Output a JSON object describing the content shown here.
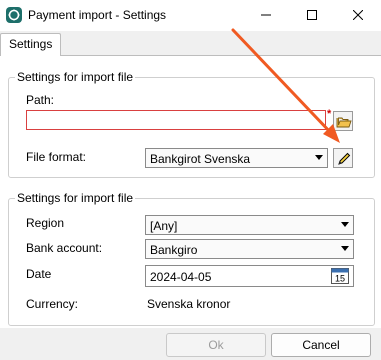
{
  "window": {
    "title": "Payment import - Settings"
  },
  "tabs": [
    {
      "label": "Settings"
    }
  ],
  "import_file": {
    "group_title": "Settings for import file",
    "path_label": "Path:",
    "path_value": "",
    "required_marker": "*",
    "format_label": "File format:",
    "format_value": "Bankgirot Svenska"
  },
  "import_settings": {
    "group_title": "Settings for import file",
    "region_label": "Region",
    "region_value": "[Any]",
    "bank_label": "Bank account:",
    "bank_value": "Bankgiro",
    "date_label": "Date",
    "date_value": "2024-04-05",
    "calendar_day": "15",
    "currency_label": "Currency:",
    "currency_value": "Svenska kronor"
  },
  "buttons": {
    "ok": "Ok",
    "cancel": "Cancel"
  },
  "colors": {
    "arrow": "#f05a22",
    "required_border": "#d94040",
    "app_icon": "#1d6f6a"
  }
}
